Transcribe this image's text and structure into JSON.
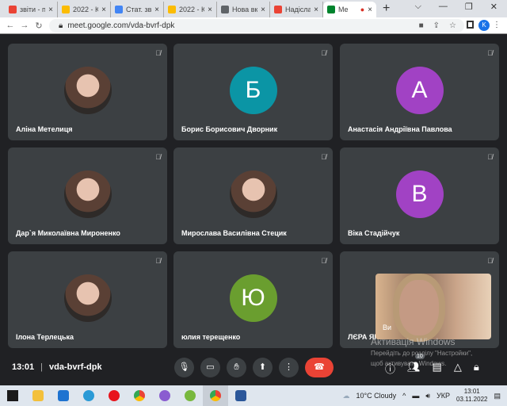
{
  "browser": {
    "tabs": [
      {
        "title": "звіти - п",
        "icon": "gmail-icon",
        "color": "#ea4335"
      },
      {
        "title": "2022 - К",
        "icon": "drive-icon",
        "color": "#fbbc04"
      },
      {
        "title": "Стат. зв",
        "icon": "docs-icon",
        "color": "#4285f4"
      },
      {
        "title": "2022 - К",
        "icon": "drive-icon",
        "color": "#fbbc04"
      },
      {
        "title": "Нова вк",
        "icon": "chrome-icon",
        "color": "#5f6368"
      },
      {
        "title": "Надісла",
        "icon": "gmail-icon",
        "color": "#ea4335"
      },
      {
        "title": "Me",
        "icon": "meet-icon",
        "color": "#00832d",
        "active": true
      }
    ],
    "url": "meet.google.com/vda-bvrf-dpk",
    "profile_initial": "K"
  },
  "tiles": [
    {
      "name": "Аліна Метелиця",
      "photo": true
    },
    {
      "name": "Борис Борисович Дворник",
      "initial": "Б",
      "color": "#0b95a5"
    },
    {
      "name": "Анастасія Андріївна Павлова",
      "initial": "А",
      "color": "#a142c4"
    },
    {
      "name": "Дар`я Миколаївна Мироненко",
      "photo": true
    },
    {
      "name": "Мирослава Василівна Стецик",
      "photo": true
    },
    {
      "name": "Віка Стадійчук",
      "initial": "В",
      "color": "#a142c4"
    },
    {
      "name": "Ілона Терлецька",
      "photo": true
    },
    {
      "name": "юлия терещенко",
      "initial": "Ю",
      "color": "#6a9e2f"
    },
    {
      "name": "ЛЄРА ЯК",
      "photo": false
    }
  ],
  "self_view": {
    "label": "Ви"
  },
  "watermark": {
    "title": "Активація Windows",
    "line1": "Перейдіть до розділу \"Настройки\",",
    "line2": "щоб активувати Windows."
  },
  "meeting": {
    "time": "13:01",
    "code": "vda-bvrf-dpk",
    "participants_count": "10"
  },
  "taskbar": {
    "weather": "10°C  Cloudy",
    "lang": "УКР",
    "time": "13:01",
    "date": "03.11.2022"
  }
}
